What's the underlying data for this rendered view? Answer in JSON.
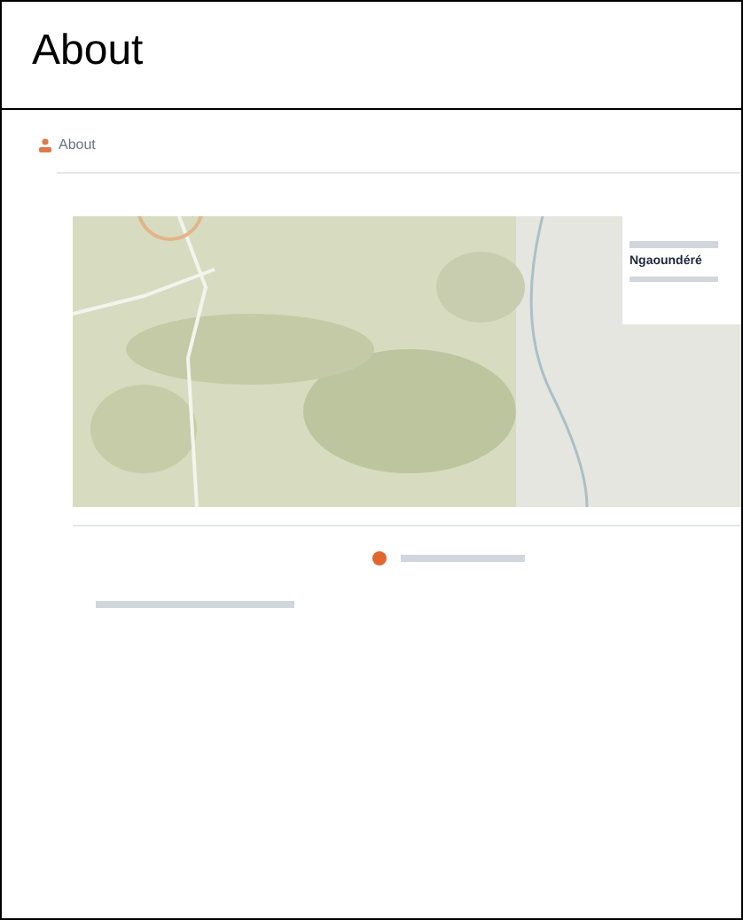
{
  "cell": {
    "title": "About"
  },
  "embedded_page": {
    "heading": "About",
    "location_card": {
      "name": "Ngaoundéré"
    }
  }
}
